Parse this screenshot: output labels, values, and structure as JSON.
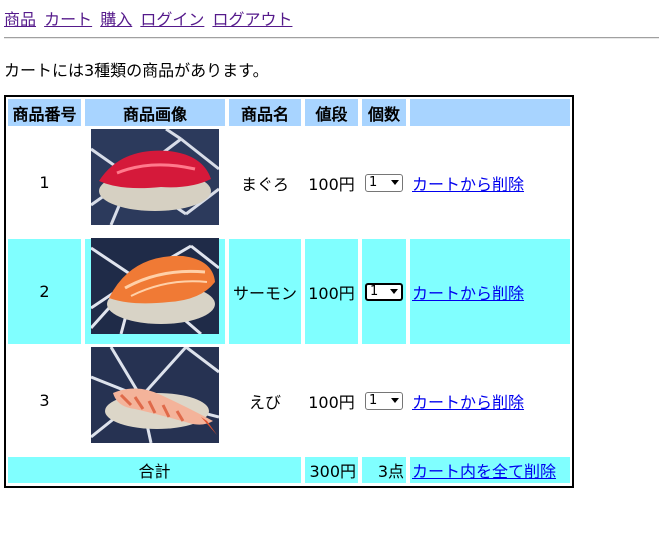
{
  "nav": {
    "links": [
      "商品",
      "カート",
      "購入",
      "ログイン",
      "ログアウト"
    ]
  },
  "message": "カートには3種類の商品があります。",
  "table": {
    "headers": [
      "商品番号",
      "商品画像",
      "商品名",
      "値段",
      "個数",
      ""
    ],
    "rows": [
      {
        "id": "1",
        "image": "maguro-sushi-image",
        "name": "まぐろ",
        "price": "100円",
        "qty": "1",
        "action": "カートから削除"
      },
      {
        "id": "2",
        "image": "salmon-sushi-image",
        "name": "サーモン",
        "price": "100円",
        "qty": "1",
        "action": "カートから削除"
      },
      {
        "id": "3",
        "image": "ebi-sushi-image",
        "name": "えび",
        "price": "100円",
        "qty": "1",
        "action": "カートから削除"
      }
    ],
    "footer": {
      "label": "合計",
      "total_price": "300円",
      "total_qty": "3点",
      "action": "カート内を全て削除"
    }
  },
  "colors": {
    "header_bg": "#a8d4ff",
    "highlight_bg": "#80ffff",
    "link": "#0000ee",
    "visited_link": "#551a8b"
  }
}
